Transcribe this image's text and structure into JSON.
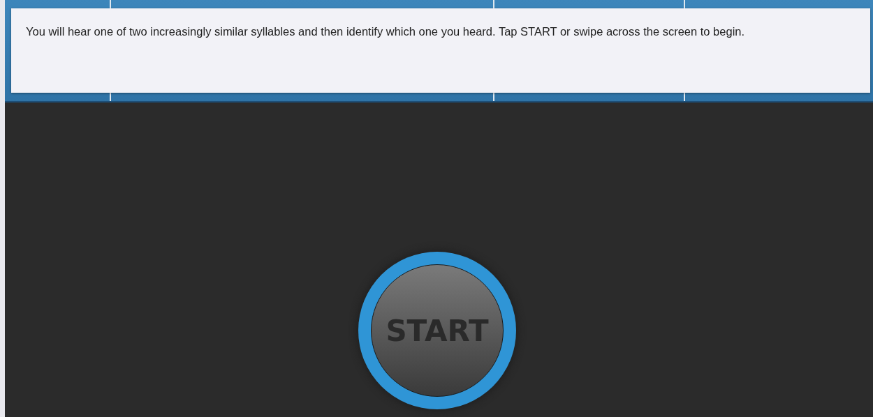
{
  "instruction": {
    "text": "You will hear one of two increasingly similar syllables and then identify which one you heard. Tap START or swipe across the screen to begin."
  },
  "start_button": {
    "label": "START"
  }
}
